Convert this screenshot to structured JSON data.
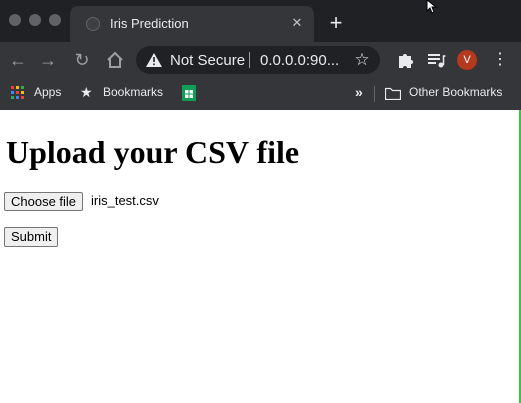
{
  "browser": {
    "tab": {
      "title": "Iris Prediction"
    },
    "omnibox": {
      "security_label": "Not Secure",
      "url": "0.0.0.0:90..."
    },
    "profile_initial": "V",
    "bookmarks": {
      "apps_label": "Apps",
      "bookmarks_label": "Bookmarks",
      "other_label": "Other Bookmarks"
    },
    "colors": {
      "frame": "#202124",
      "toolbar": "#35363a",
      "avatar": "#b5391f"
    }
  },
  "page": {
    "heading": "Upload your CSV file",
    "file_input": {
      "button_label": "Choose file",
      "selected_file": "iris_test.csv"
    },
    "submit_label": "Submit"
  }
}
